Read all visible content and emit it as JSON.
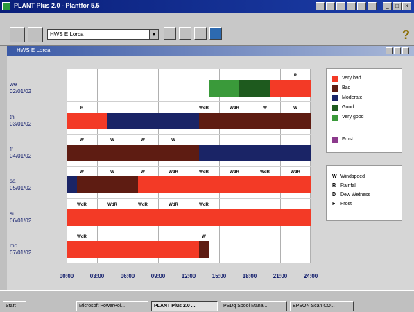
{
  "window": {
    "title": "PLANT Plus 2.0 - Plantfor 5.5"
  },
  "toolbar": {
    "station": "HWS E Lorca",
    "help": "?"
  },
  "child_window": {
    "title": "HWS E Lorca"
  },
  "colors": {
    "very_bad": "#f33a26",
    "bad": "#5e1c12",
    "moderate": "#1a2466",
    "good": "#1e5a1e",
    "very_good": "#3a9a3a",
    "frost": "#8c3a8c"
  },
  "chart_data": {
    "type": "bar",
    "x_ticks": [
      "00:00",
      "03:00",
      "06:00",
      "09:00",
      "12:00",
      "15:00",
      "18:00",
      "21:00",
      "24:00"
    ],
    "xlim_hours": [
      0,
      24
    ],
    "rows": [
      {
        "day": "we",
        "date": "02/01/02",
        "segments": [
          {
            "from": 14,
            "to": 17,
            "risk": "very_good"
          },
          {
            "from": 17,
            "to": 20,
            "risk": "good"
          },
          {
            "from": 20,
            "to": 24,
            "risk": "very_bad"
          }
        ],
        "tags": [
          {
            "hour": 22.5,
            "text": "R"
          }
        ]
      },
      {
        "day": "th",
        "date": "03/01/02",
        "segments": [
          {
            "from": 0,
            "to": 4,
            "risk": "very_bad"
          },
          {
            "from": 4,
            "to": 13,
            "risk": "moderate"
          },
          {
            "from": 13,
            "to": 24,
            "risk": "bad"
          }
        ],
        "tags": [
          {
            "hour": 1.5,
            "text": "R"
          },
          {
            "hour": 13.5,
            "text": "WdR"
          },
          {
            "hour": 16.5,
            "text": "WdR"
          },
          {
            "hour": 19.5,
            "text": "W"
          },
          {
            "hour": 22.5,
            "text": "W"
          }
        ]
      },
      {
        "day": "fr",
        "date": "04/01/02",
        "segments": [
          {
            "from": 0,
            "to": 13,
            "risk": "bad"
          },
          {
            "from": 13,
            "to": 24,
            "risk": "moderate"
          }
        ],
        "tags": [
          {
            "hour": 1.5,
            "text": "W"
          },
          {
            "hour": 4.5,
            "text": "W"
          },
          {
            "hour": 7.5,
            "text": "W"
          },
          {
            "hour": 10.5,
            "text": "W"
          }
        ]
      },
      {
        "day": "sa",
        "date": "05/01/02",
        "segments": [
          {
            "from": 0,
            "to": 1,
            "risk": "moderate"
          },
          {
            "from": 1,
            "to": 7,
            "risk": "bad"
          },
          {
            "from": 7,
            "to": 24,
            "risk": "very_bad"
          }
        ],
        "tags": [
          {
            "hour": 1.5,
            "text": "W"
          },
          {
            "hour": 4.5,
            "text": "W"
          },
          {
            "hour": 7.5,
            "text": "W"
          },
          {
            "hour": 10.5,
            "text": "WdR"
          },
          {
            "hour": 13.5,
            "text": "WdR"
          },
          {
            "hour": 16.5,
            "text": "WdR"
          },
          {
            "hour": 19.5,
            "text": "WdR"
          },
          {
            "hour": 22.5,
            "text": "WdR"
          }
        ]
      },
      {
        "day": "su",
        "date": "06/01/02",
        "segments": [
          {
            "from": 0,
            "to": 24,
            "risk": "very_bad"
          }
        ],
        "tags": [
          {
            "hour": 1.5,
            "text": "WdR"
          },
          {
            "hour": 4.5,
            "text": "WdR"
          },
          {
            "hour": 7.5,
            "text": "WdR"
          },
          {
            "hour": 10.5,
            "text": "WdR"
          },
          {
            "hour": 13.5,
            "text": "WdR"
          }
        ]
      },
      {
        "day": "mo",
        "date": "07/01/02",
        "segments": [
          {
            "from": 0,
            "to": 13,
            "risk": "very_bad"
          },
          {
            "from": 13,
            "to": 14,
            "risk": "bad"
          }
        ],
        "tags": [
          {
            "hour": 1.5,
            "text": "WdR"
          },
          {
            "hour": 13.5,
            "text": "W"
          }
        ]
      }
    ]
  },
  "legend": [
    {
      "key": "very_bad",
      "label": "Very bad"
    },
    {
      "key": "bad",
      "label": "Bad"
    },
    {
      "key": "moderate",
      "label": "Moderate"
    },
    {
      "key": "good",
      "label": "Good"
    },
    {
      "key": "very_good",
      "label": "Very good"
    },
    {
      "key": "frost",
      "label": "Frost"
    }
  ],
  "code_legend": [
    {
      "code": "W",
      "label": "Windspeed"
    },
    {
      "code": "R",
      "label": "Rainfall"
    },
    {
      "code": "D",
      "label": "Dew Wetness"
    },
    {
      "code": "F",
      "label": "Frost"
    }
  ],
  "taskbar": [
    {
      "label": "Start"
    },
    {
      "label": "Microsoft PowerPoi..."
    },
    {
      "label": "PLANT Plus 2.0 ...",
      "active": true
    },
    {
      "label": "PSDq Spool Mana..."
    },
    {
      "label": "EPSON Scan CO..."
    }
  ]
}
